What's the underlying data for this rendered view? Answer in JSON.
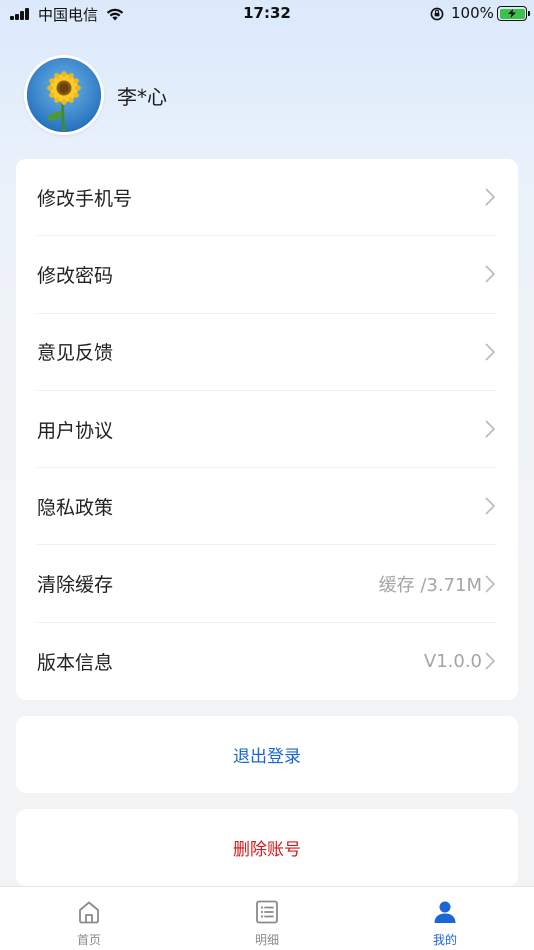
{
  "status_bar": {
    "carrier": "中国电信",
    "time": "17:32",
    "battery": "100%"
  },
  "profile": {
    "name": "李*心"
  },
  "settings": {
    "items": [
      {
        "label": "修改手机号",
        "value": ""
      },
      {
        "label": "修改密码",
        "value": ""
      },
      {
        "label": "意见反馈",
        "value": ""
      },
      {
        "label": "用户协议",
        "value": ""
      },
      {
        "label": "隐私政策",
        "value": ""
      },
      {
        "label": "清除缓存",
        "value": "缓存 /3.71M"
      },
      {
        "label": "版本信息",
        "value": "V1.0.0"
      }
    ]
  },
  "actions": {
    "logout": "退出登录",
    "delete_account": "删除账号"
  },
  "tab_bar": {
    "tabs": [
      {
        "label": "首页",
        "icon": "home-icon"
      },
      {
        "label": "明细",
        "icon": "list-icon"
      },
      {
        "label": "我的",
        "icon": "user-icon"
      }
    ],
    "active": 2
  },
  "colors": {
    "accent": "#1a66d6",
    "danger": "#d11a1a",
    "value_gray": "#a5a5a5"
  }
}
